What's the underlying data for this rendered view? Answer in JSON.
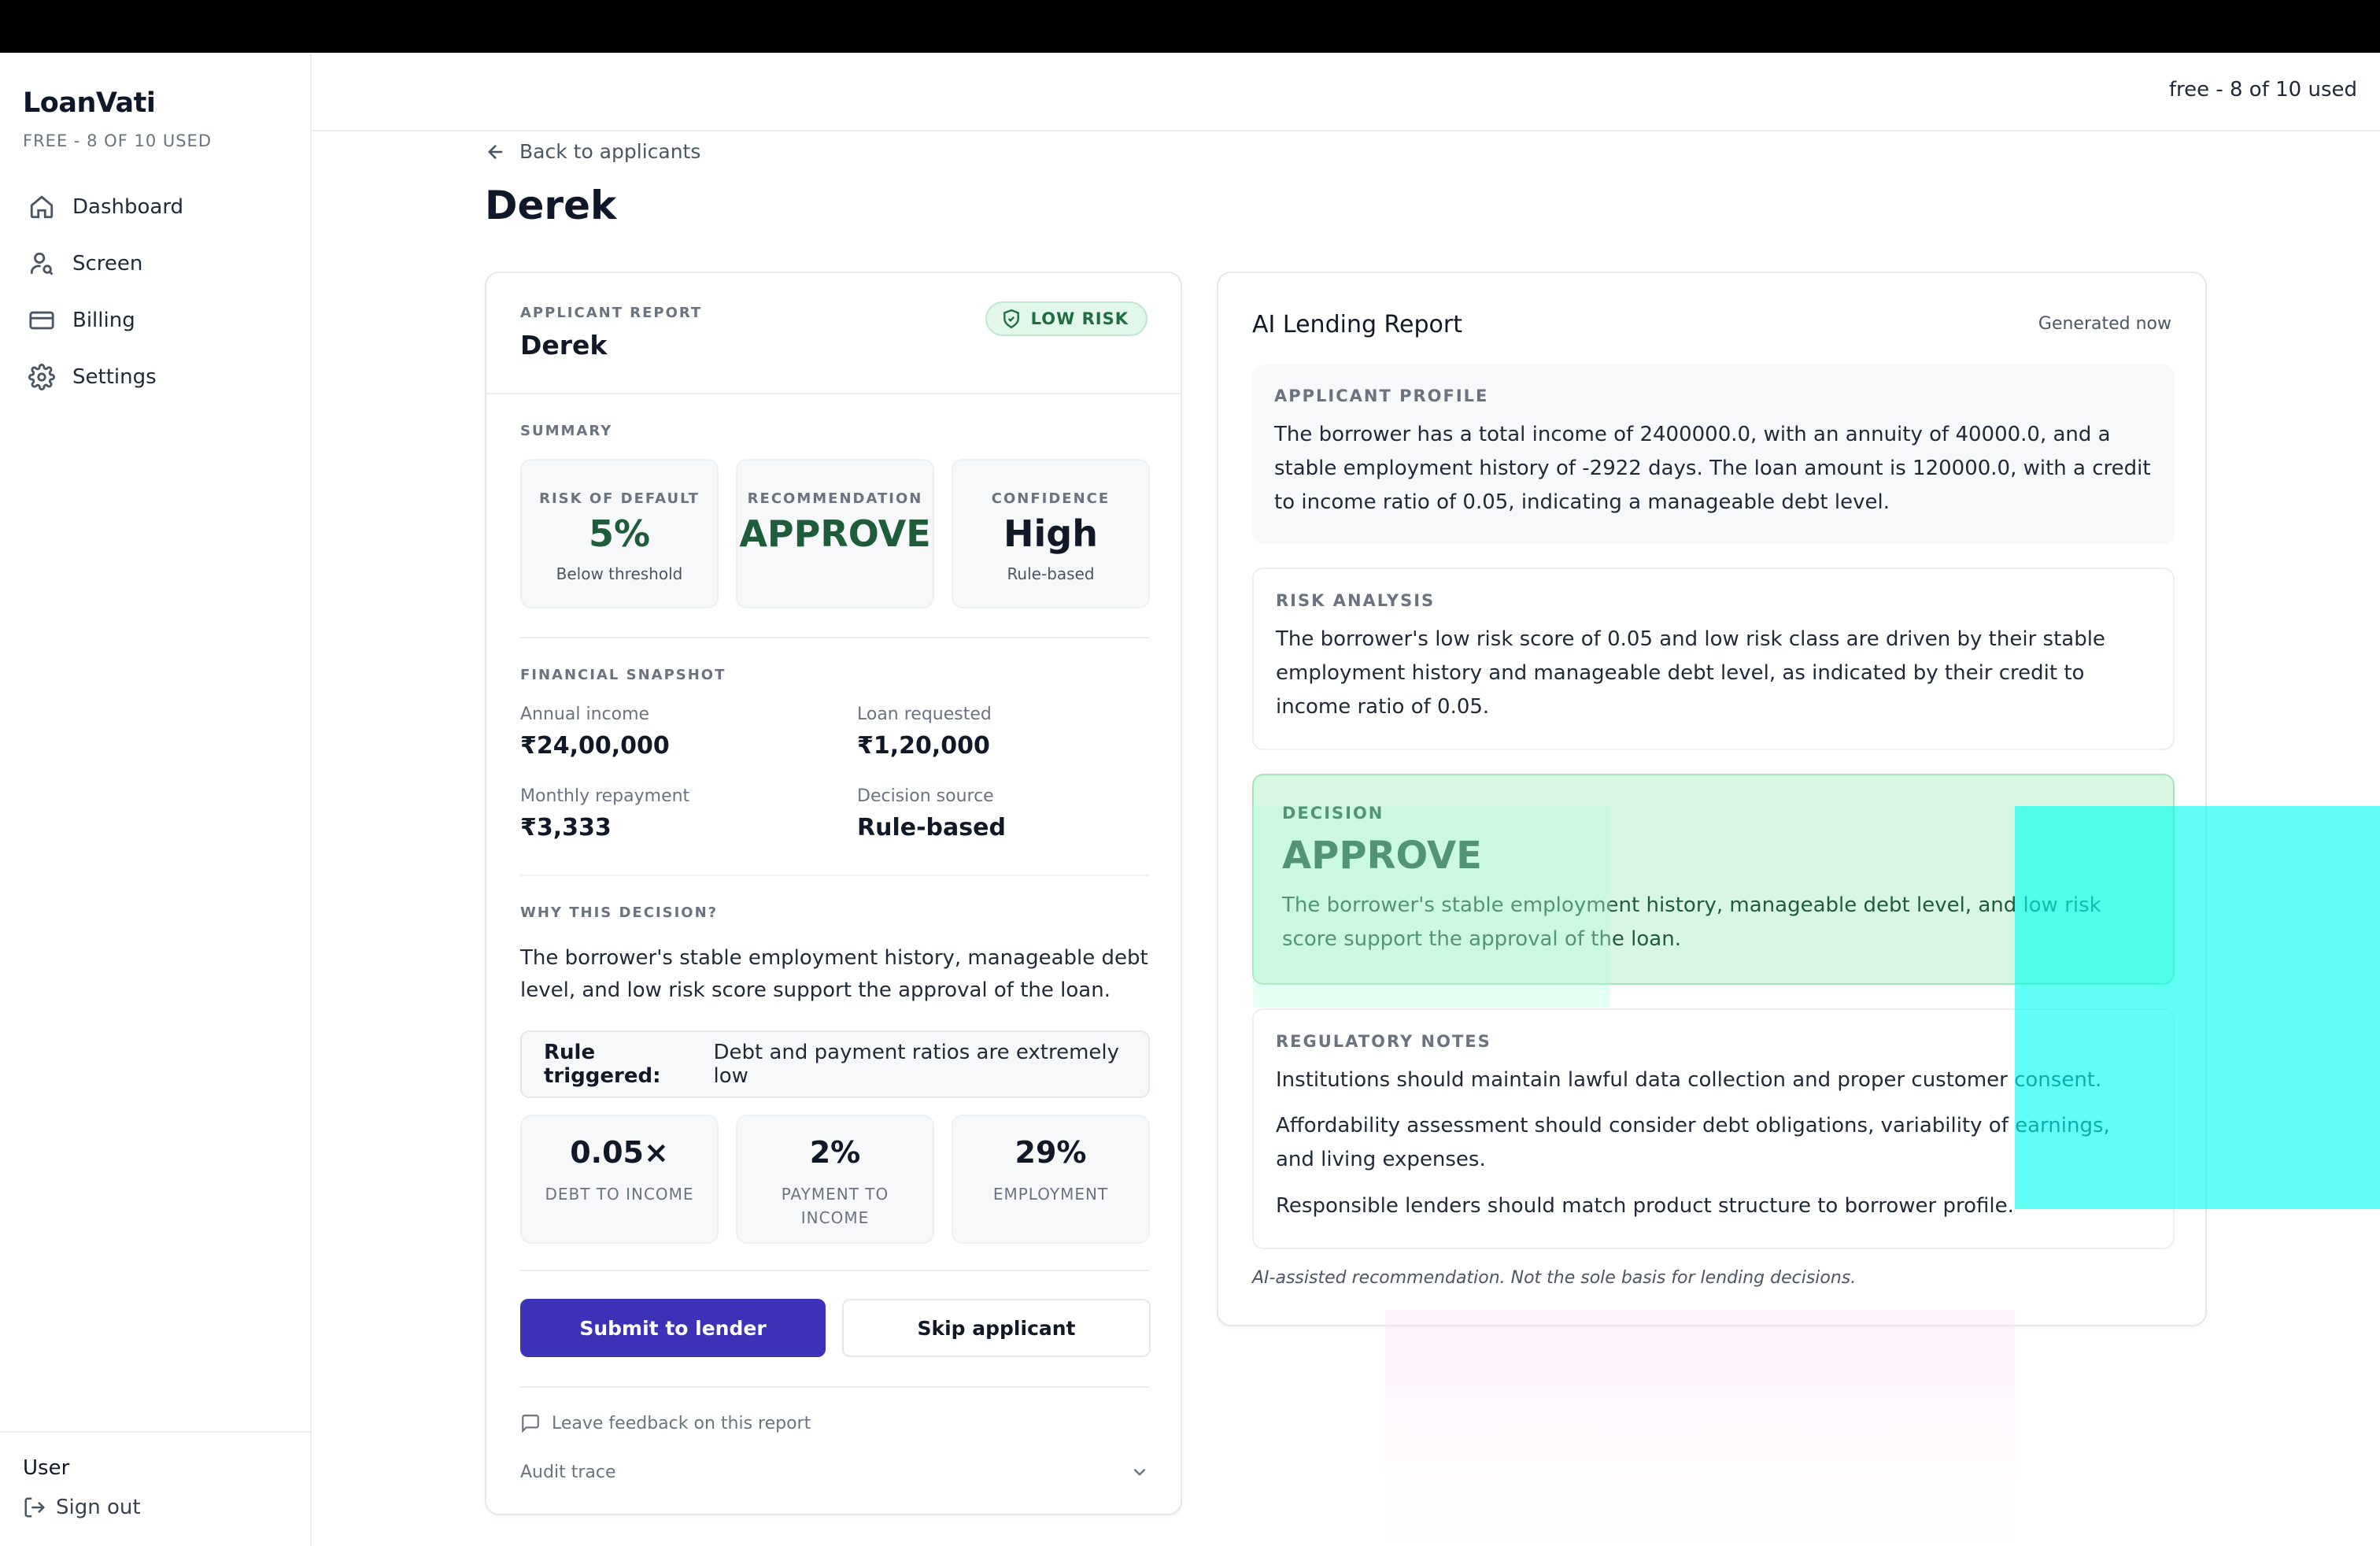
{
  "app": {
    "name": "LoanVati",
    "plan_badge": "FREE - 8 OF 10 USED",
    "header_usage": "free - 8 of 10 used"
  },
  "sidebar": {
    "items": [
      {
        "label": "Dashboard",
        "icon": "home-icon"
      },
      {
        "label": "Screen",
        "icon": "user-search-icon"
      },
      {
        "label": "Billing",
        "icon": "credit-card-icon"
      },
      {
        "label": "Settings",
        "icon": "gear-icon"
      }
    ],
    "user_label": "User",
    "signout_label": "Sign out"
  },
  "page": {
    "back_label": "Back to applicants",
    "title": "Derek"
  },
  "applicant_report": {
    "eyebrow": "APPLICANT REPORT",
    "name": "Derek",
    "risk_badge": "LOW RISK",
    "summary_label": "SUMMARY",
    "summary": [
      {
        "label": "RISK OF DEFAULT",
        "value": "5%",
        "sub": "Below threshold"
      },
      {
        "label": "RECOMMENDATION",
        "value": "APPROVE",
        "sub": ""
      },
      {
        "label": "CONFIDENCE",
        "value": "High",
        "sub": "Rule-based"
      }
    ],
    "financial_label": "FINANCIAL SNAPSHOT",
    "financial": [
      {
        "label": "Annual income",
        "value": "₹24,00,000"
      },
      {
        "label": "Loan requested",
        "value": "₹1,20,000"
      },
      {
        "label": "Monthly repayment",
        "value": "₹3,333"
      },
      {
        "label": "Decision source",
        "value": "Rule-based"
      }
    ],
    "why_label": "WHY THIS DECISION?",
    "why_text": "The borrower's stable employment history, manageable debt level, and low risk score support the approval of the loan.",
    "rule_prefix": "Rule triggered:",
    "rule_text": "Debt and payment ratios are extremely low",
    "metrics": [
      {
        "value": "0.05×",
        "label": "DEBT TO INCOME"
      },
      {
        "value": "2%",
        "label": "PAYMENT TO INCOME"
      },
      {
        "value": "29%",
        "label": "EMPLOYMENT"
      }
    ],
    "submit_label": "Submit to lender",
    "skip_label": "Skip applicant",
    "feedback_label": "Leave feedback on this report",
    "audit_label": "Audit trace"
  },
  "ai_report": {
    "title": "AI Lending Report",
    "generated": "Generated now",
    "profile_label": "APPLICANT PROFILE",
    "profile_text": "The borrower has a total income of 2400000.0, with an annuity of 40000.0, and a stable employment history of -2922 days. The loan amount is 120000.0, with a credit to income ratio of 0.05, indicating a manageable debt level.",
    "risk_label": "RISK ANALYSIS",
    "risk_text": "The borrower's low risk score of 0.05 and low risk class are driven by their stable employment history and manageable debt level, as indicated by their credit to income ratio of 0.05.",
    "decision_label": "DECISION",
    "decision_value": "APPROVE",
    "decision_text": "The borrower's stable employment history, manageable debt level, and low risk score support the approval of the loan.",
    "regulatory_label": "REGULATORY NOTES",
    "regulatory": [
      "Institutions should maintain lawful data collection and proper customer consent.",
      "Affordability assessment should consider debt obligations, variability of earnings, and living expenses.",
      "Responsible lenders should match product structure to borrower profile."
    ],
    "disclaimer": "AI-assisted recommendation. Not the sole basis for lending decisions."
  },
  "colors": {
    "primary": "#3b32b8",
    "approve_green": "#1f5c3a",
    "risk_pill_bg": "#e3f6ea",
    "decision_bg": "#d8f6e0"
  }
}
